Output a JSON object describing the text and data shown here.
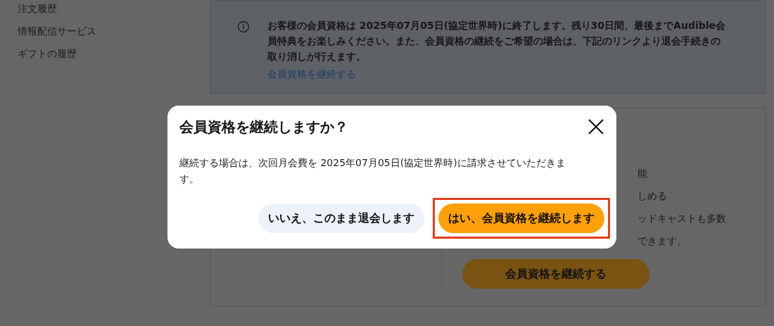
{
  "sidebar": {
    "items": [
      "注文履歴",
      "情報配信サービス",
      "ギフトの履歴"
    ]
  },
  "notice": {
    "text": "お客様の会員資格は 2025年07月05日(協定世界時)に終了します。残り30日間、最後までAudible会員特典をお楽しみください。また、会員資格の継続をご希望の場合は、下記のリンクより退会手続きの取り消しが行えます。",
    "link": "会員資格を継続する"
  },
  "card": {
    "features": [
      "能",
      "しめる",
      "ッドキャストも多数",
      "できます。"
    ],
    "button": "会員資格を継続する"
  },
  "dialog": {
    "title": "会員資格を継続しますか？",
    "body": "継続する場合は、次回月会費を 2025年07月05日(協定世界時)に請求させていただきます。",
    "buttons": [
      {
        "label": "いいえ、このまま退会します",
        "kind": "secondary",
        "highlighted": false
      },
      {
        "label": "はい、会員資格を継続します",
        "kind": "primary",
        "highlighted": true
      }
    ]
  }
}
